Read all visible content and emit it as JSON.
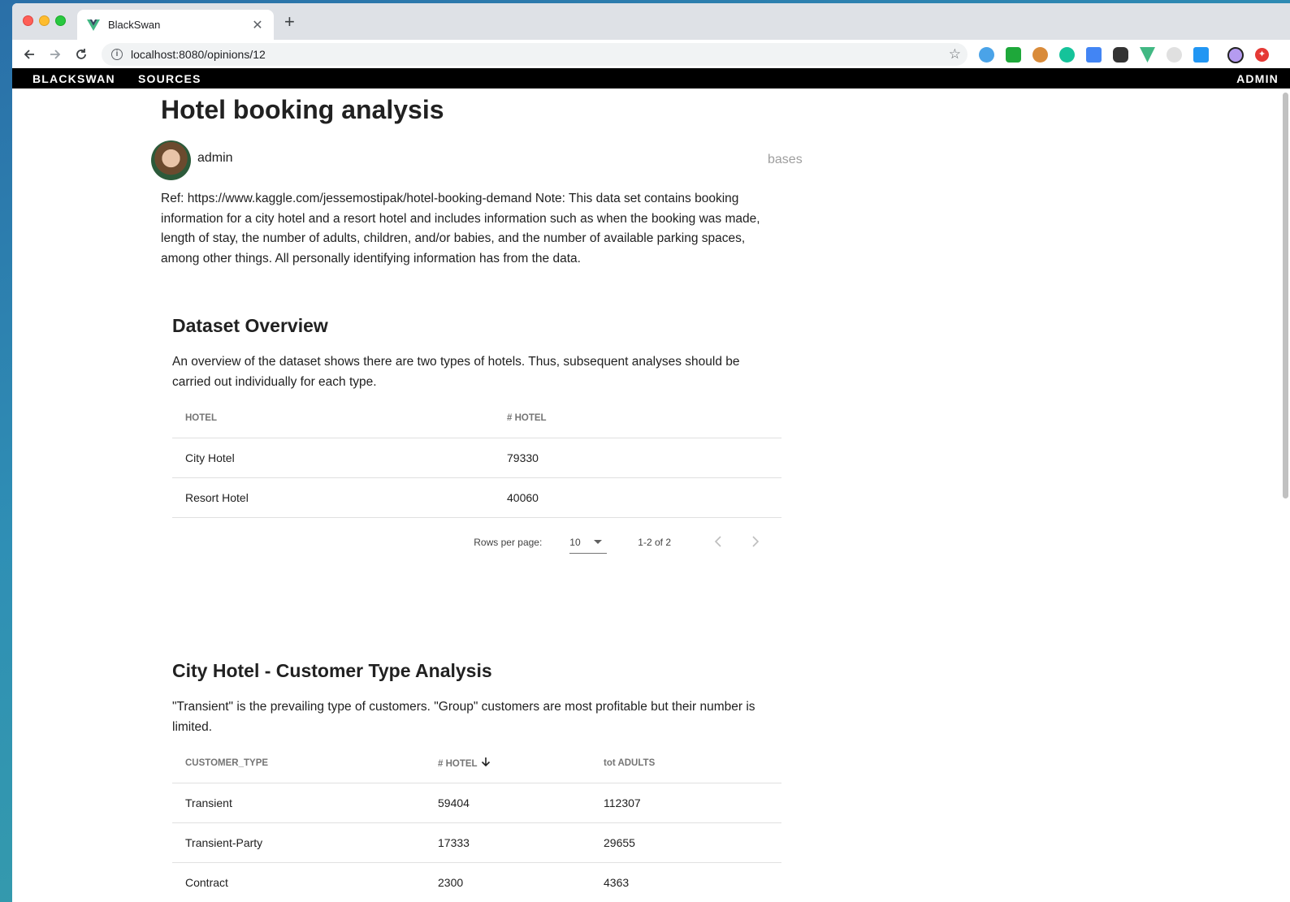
{
  "browser": {
    "tab_title": "BlackSwan",
    "tab_close": "✕",
    "new_tab": "+",
    "url": "localhost:8080/opinions/12",
    "info": "i",
    "star": "☆"
  },
  "appbar": {
    "brand": "BLACKSWAN",
    "sources": "SOURCES",
    "admin": "ADMIN"
  },
  "article": {
    "title": "Hotel booking analysis",
    "author": "admin",
    "tag": "bases",
    "intro": "Ref: https://www.kaggle.com/jessemostipak/hotel-booking-demand Note: This data set contains booking information for a city hotel and a resort hotel and includes information such as when the booking was made, length of stay, the number of adults, children, and/or babies, and the number of available parking spaces, among other things. All personally identifying information has from the data."
  },
  "overview": {
    "title": "Dataset Overview",
    "text": "An overview of the dataset shows there are two types of hotels. Thus, subsequent analyses should be carried out individually for each type.",
    "headers": [
      "HOTEL",
      "# HOTEL"
    ],
    "rows": [
      [
        "City Hotel",
        "79330"
      ],
      [
        "Resort Hotel",
        "40060"
      ]
    ],
    "rows_per_page_label": "Rows per page:",
    "rows_per_page": "10",
    "range": "1-2 of 2"
  },
  "customer": {
    "title": "City Hotel - Customer Type Analysis",
    "text": "\"Transient\" is the prevailing type of customers. \"Group\" customers are most profitable but their number is limited.",
    "headers": [
      "CUSTOMER_TYPE",
      "# HOTEL",
      "tot ADULTS"
    ],
    "rows": [
      [
        "Transient",
        "59404",
        "112307"
      ],
      [
        "Transient-Party",
        "17333",
        "29655"
      ],
      [
        "Contract",
        "2300",
        "4363"
      ]
    ]
  }
}
